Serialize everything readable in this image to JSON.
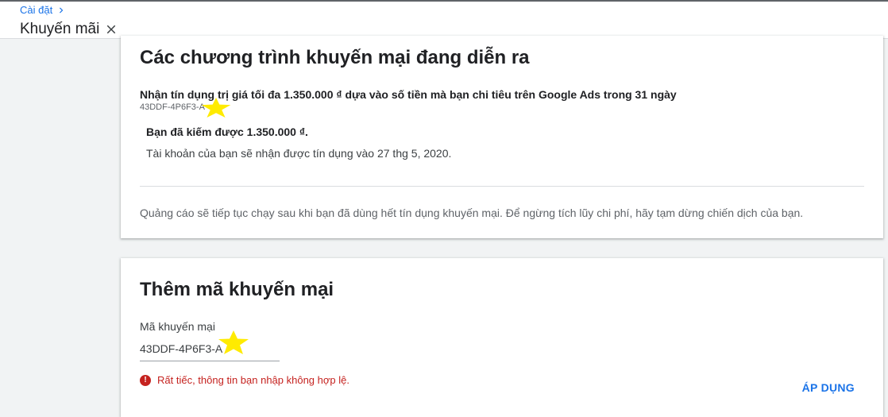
{
  "header": {
    "breadcrumb": "Cài đặt",
    "title": "Khuyến mãi",
    "close_icon": "close-icon",
    "chevron_icon": "chevron-right-icon"
  },
  "active_promotions": {
    "heading": "Các chương trình khuyến mại đang diễn ra",
    "promo_name": "Nhận tín dụng trị giá tối đa 1.350.000 ₫ dựa vào số tiền mà bạn chi tiêu trên Google Ads trong 31 ngày",
    "promo_code": "43DDF-4P6F3-A",
    "earned": "Bạn đã kiếm được 1.350.000 ₫.",
    "credit_note": "Tài khoản của bạn sẽ nhận được tín dụng vào 27 thg 5, 2020.",
    "footnote": "Quảng cáo sẽ tiếp tục chạy sau khi bạn đã dùng hết tín dụng khuyến mại. Để ngừng tích lũy chi phí, hãy tạm dừng chiến dịch của bạn."
  },
  "add_code": {
    "heading": "Thêm mã khuyến mại",
    "field_label": "Mã khuyến mại",
    "field_value": "43DDF-4P6F3-A",
    "error_text": "Rất tiếc, thông tin bạn nhập không hợp lệ.",
    "error_icon": "error-icon",
    "apply_label": "ÁP DỤNG"
  },
  "colors": {
    "accent": "#1a73e8",
    "error": "#c5221f",
    "star": "#ffeb00"
  }
}
